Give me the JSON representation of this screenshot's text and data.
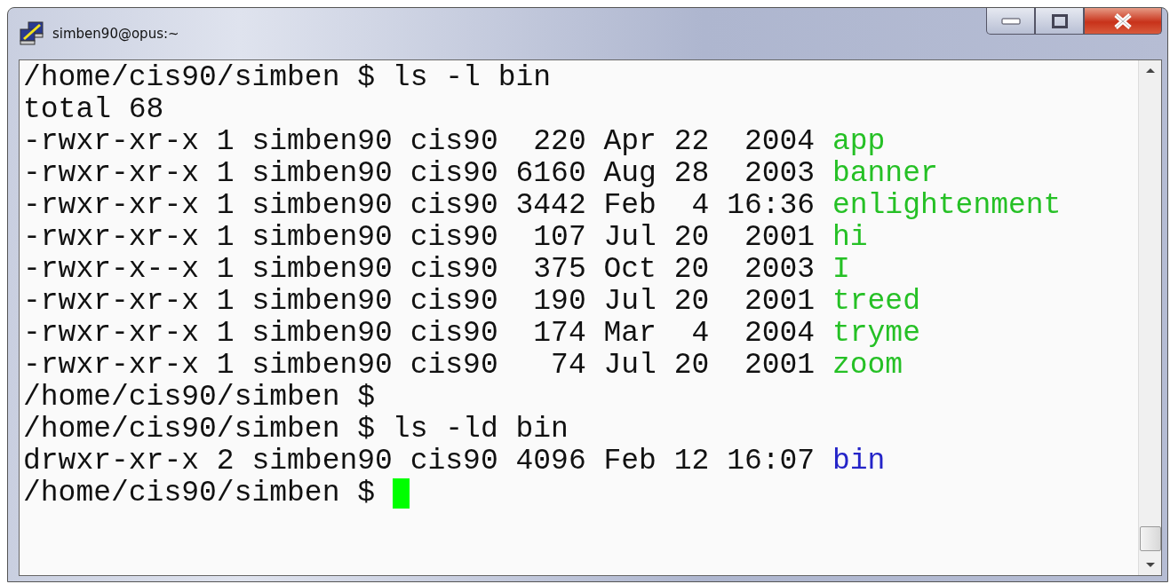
{
  "window": {
    "title": "simben90@opus:~"
  },
  "terminal": {
    "lines": [
      {
        "segments": [
          {
            "kind": "plain",
            "text": "/home/cis90/simben $ ls -l bin"
          }
        ]
      },
      {
        "segments": [
          {
            "kind": "plain",
            "text": "total 68"
          }
        ]
      },
      {
        "segments": [
          {
            "kind": "plain",
            "text": "-rwxr-xr-x 1 simben90 cis90  220 Apr 22  2004 "
          },
          {
            "kind": "executable",
            "text": "app"
          }
        ]
      },
      {
        "segments": [
          {
            "kind": "plain",
            "text": "-rwxr-xr-x 1 simben90 cis90 6160 Aug 28  2003 "
          },
          {
            "kind": "executable",
            "text": "banner"
          }
        ]
      },
      {
        "segments": [
          {
            "kind": "plain",
            "text": "-rwxr-xr-x 1 simben90 cis90 3442 Feb  4 16:36 "
          },
          {
            "kind": "executable",
            "text": "enlightenment"
          }
        ]
      },
      {
        "segments": [
          {
            "kind": "plain",
            "text": "-rwxr-xr-x 1 simben90 cis90  107 Jul 20  2001 "
          },
          {
            "kind": "executable",
            "text": "hi"
          }
        ]
      },
      {
        "segments": [
          {
            "kind": "plain",
            "text": "-rwxr-x--x 1 simben90 cis90  375 Oct 20  2003 "
          },
          {
            "kind": "executable",
            "text": "I"
          }
        ]
      },
      {
        "segments": [
          {
            "kind": "plain",
            "text": "-rwxr-xr-x 1 simben90 cis90  190 Jul 20  2001 "
          },
          {
            "kind": "executable",
            "text": "treed"
          }
        ]
      },
      {
        "segments": [
          {
            "kind": "plain",
            "text": "-rwxr-xr-x 1 simben90 cis90  174 Mar  4  2004 "
          },
          {
            "kind": "executable",
            "text": "tryme"
          }
        ]
      },
      {
        "segments": [
          {
            "kind": "plain",
            "text": "-rwxr-xr-x 1 simben90 cis90   74 Jul 20  2001 "
          },
          {
            "kind": "executable",
            "text": "zoom"
          }
        ]
      },
      {
        "segments": [
          {
            "kind": "plain",
            "text": "/home/cis90/simben $"
          }
        ]
      },
      {
        "segments": [
          {
            "kind": "plain",
            "text": "/home/cis90/simben $ ls -ld bin"
          }
        ]
      },
      {
        "segments": [
          {
            "kind": "plain",
            "text": "drwxr-xr-x 2 simben90 cis90 4096 Feb 12 16:07 "
          },
          {
            "kind": "directory",
            "text": "bin"
          }
        ]
      },
      {
        "segments": [
          {
            "kind": "plain",
            "text": "/home/cis90/simben $ "
          }
        ],
        "cursor": true
      }
    ]
  }
}
